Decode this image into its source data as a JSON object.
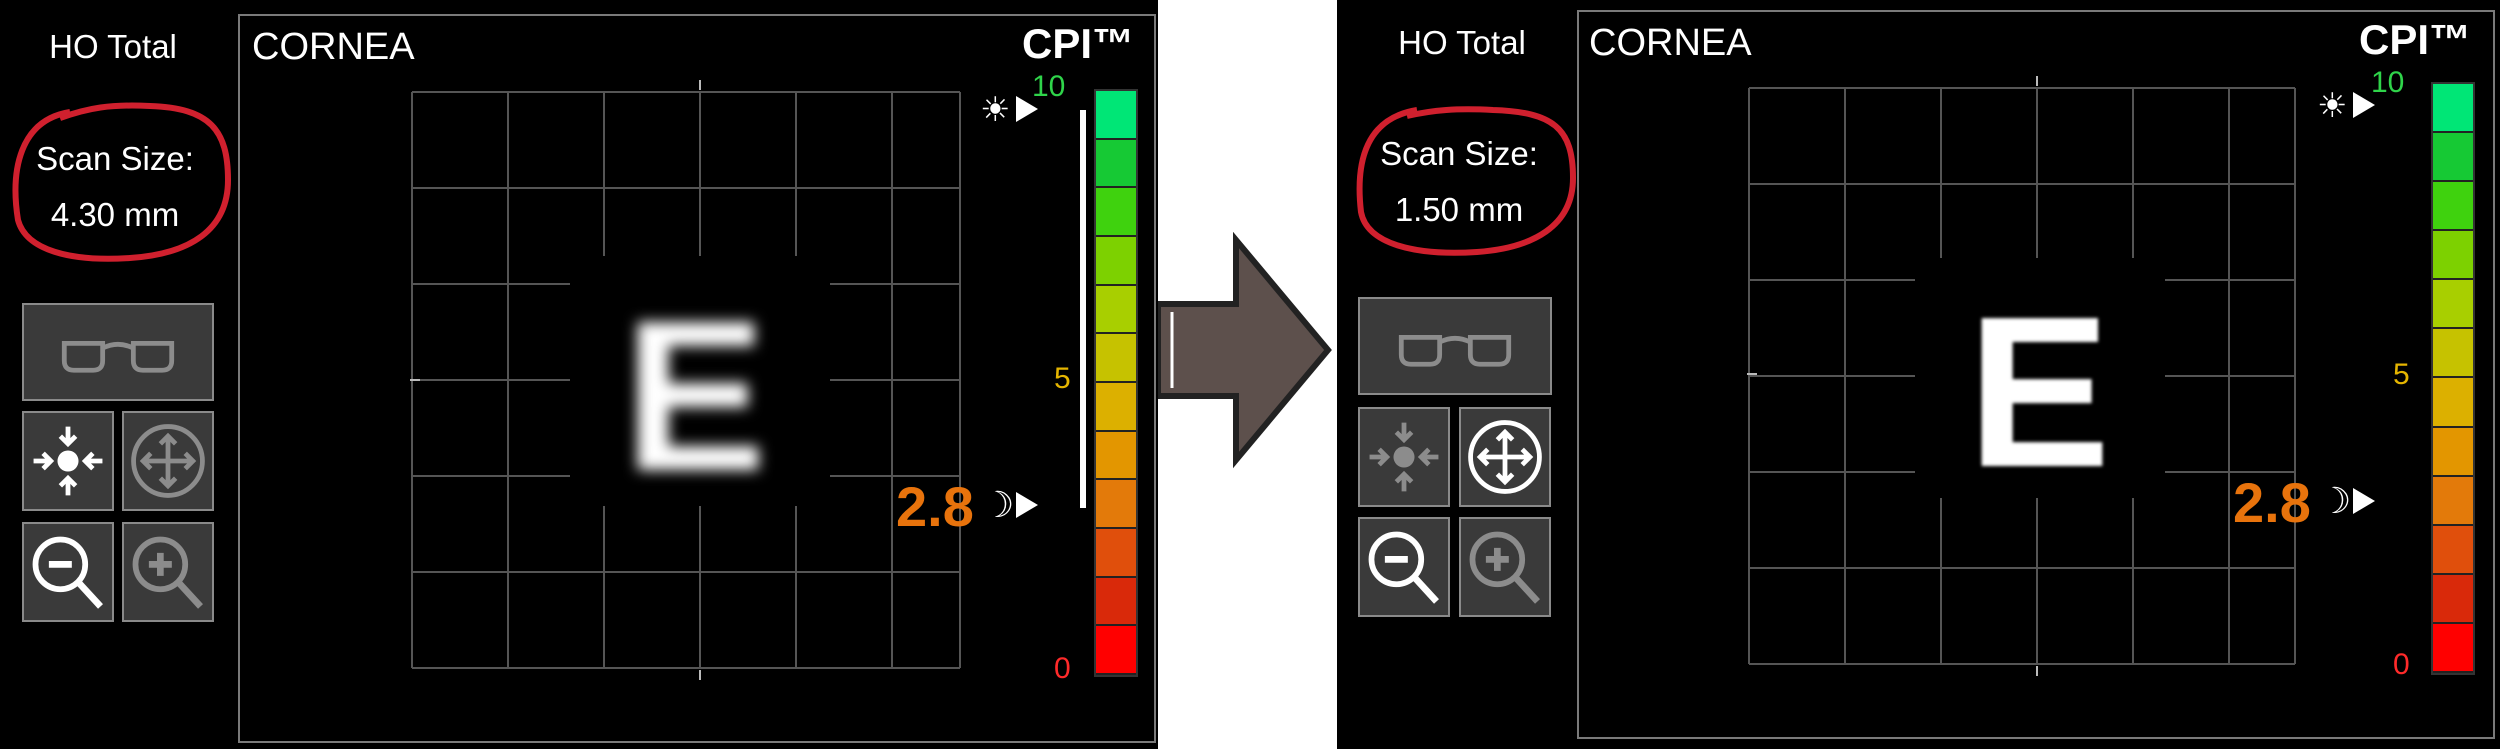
{
  "comparison": {
    "before": {
      "ho_title": "HO Total",
      "scan_size_label": "Scan Size:",
      "scan_size_value": "4.30 mm",
      "cornea_label": "CORNEA",
      "optotype": "E",
      "cpi_title": "CPI™",
      "cpi_max": "10",
      "cpi_mid": "5",
      "cpi_min": "0",
      "cpi_value": "2.8",
      "sun_symbol": "☀",
      "moon_symbol": "☽",
      "optotype_blur": "blurred",
      "center_button_active": false,
      "move_button_active": true
    },
    "after": {
      "ho_title": "HO Total",
      "scan_size_label": "Scan Size:",
      "scan_size_value": "1.50 mm",
      "cornea_label": "CORNEA",
      "optotype": "E",
      "cpi_title": "CPI™",
      "cpi_max": "10",
      "cpi_mid": "5",
      "cpi_min": "0",
      "cpi_value": "2.8",
      "sun_symbol": "☀",
      "moon_symbol": "☽",
      "optotype_blur": "sharp",
      "center_button_active": true,
      "move_button_active": false
    }
  },
  "icons": {
    "glasses": "glasses-icon",
    "center": "center-icon",
    "move": "move-icon",
    "zoom_out": "zoom-out-icon",
    "zoom_in": "zoom-in-icon",
    "transition_arrow": "right-arrow-icon"
  },
  "colors": {
    "highlight_ring": "#d0202e",
    "cpi_value": "#e8730c",
    "scale_top": "#00e676",
    "scale_bottom": "#ff0000",
    "cpi_max_label": "#2fd44a",
    "cpi_mid_label": "#e5b500",
    "cpi_min_label": "#ff2a2a",
    "arrow_fill": "#5d504c"
  }
}
